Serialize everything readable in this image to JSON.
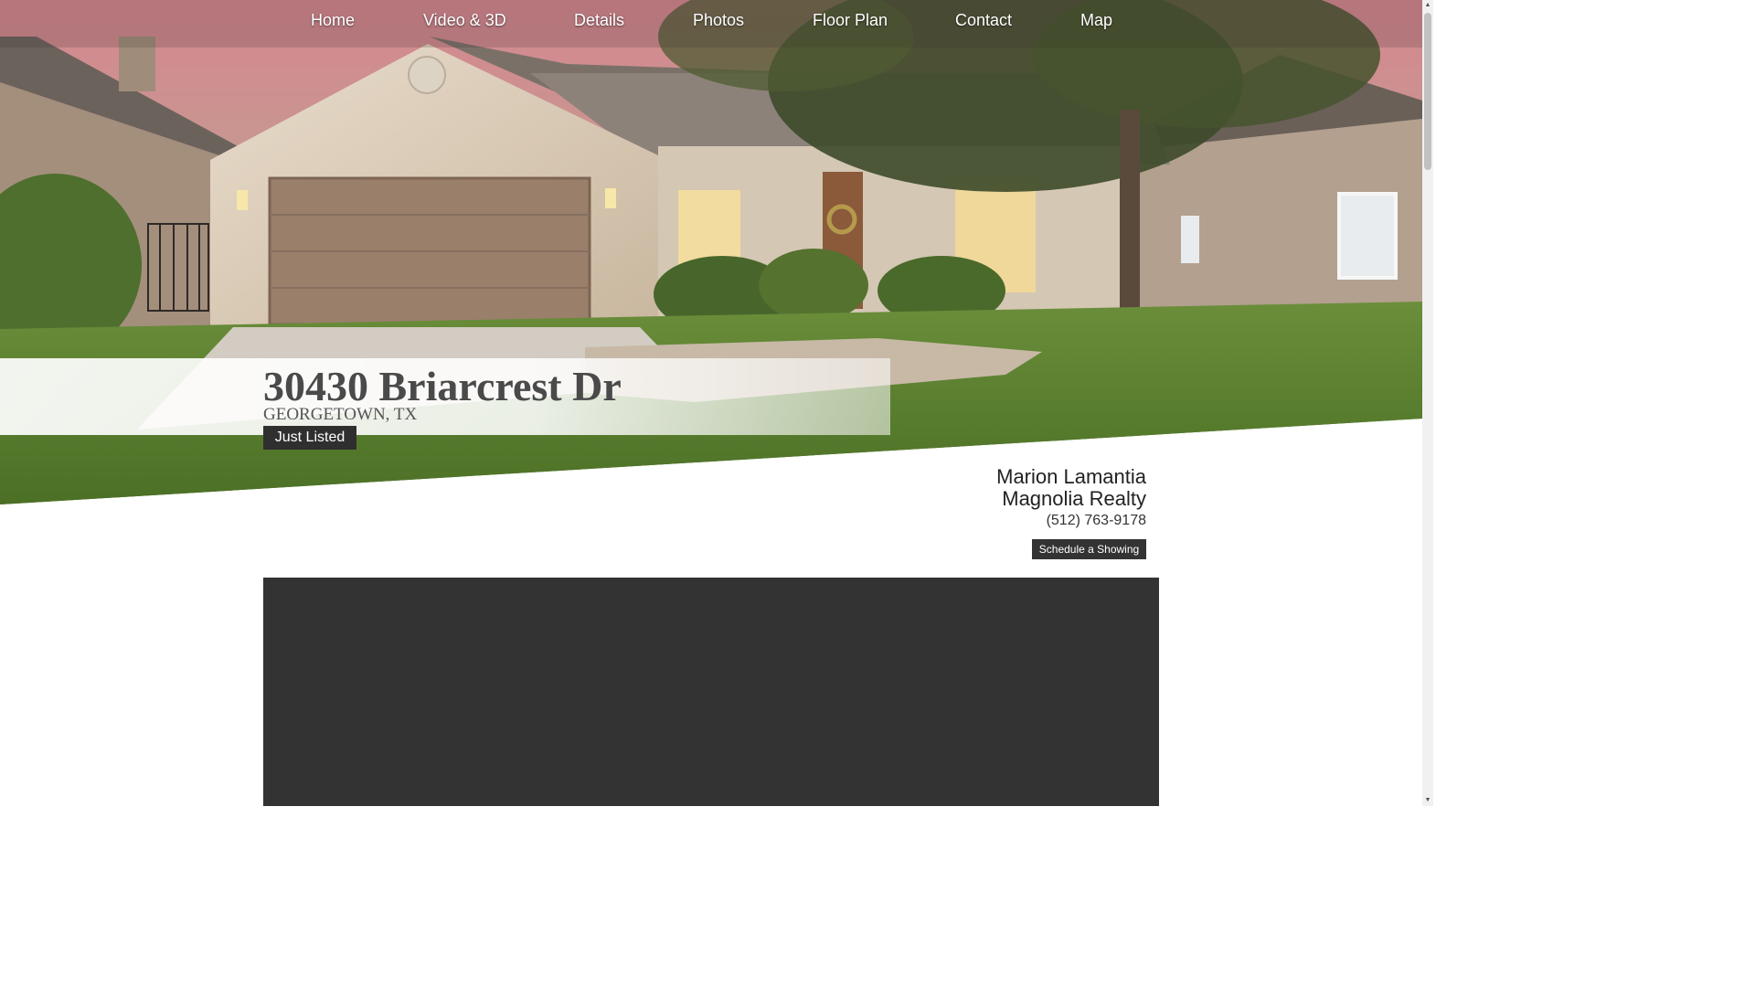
{
  "nav": {
    "items": [
      {
        "label": "Home"
      },
      {
        "label": "Video & 3D"
      },
      {
        "label": "Details"
      },
      {
        "label": "Photos"
      },
      {
        "label": "Floor Plan"
      },
      {
        "label": "Contact"
      },
      {
        "label": "Map"
      }
    ]
  },
  "listing": {
    "address": "30430 Briarcrest Dr",
    "city": "GEORGETOWN, TX",
    "badge": "Just Listed"
  },
  "agent": {
    "name": "Marion Lamantia",
    "company": "Magnolia Realty",
    "phone": "(512) 763-9178",
    "cta": "Schedule a Showing"
  },
  "colors": {
    "nav_text": "#ffffff",
    "badge_bg": "#2f2f2f",
    "video_bg": "#333333"
  }
}
